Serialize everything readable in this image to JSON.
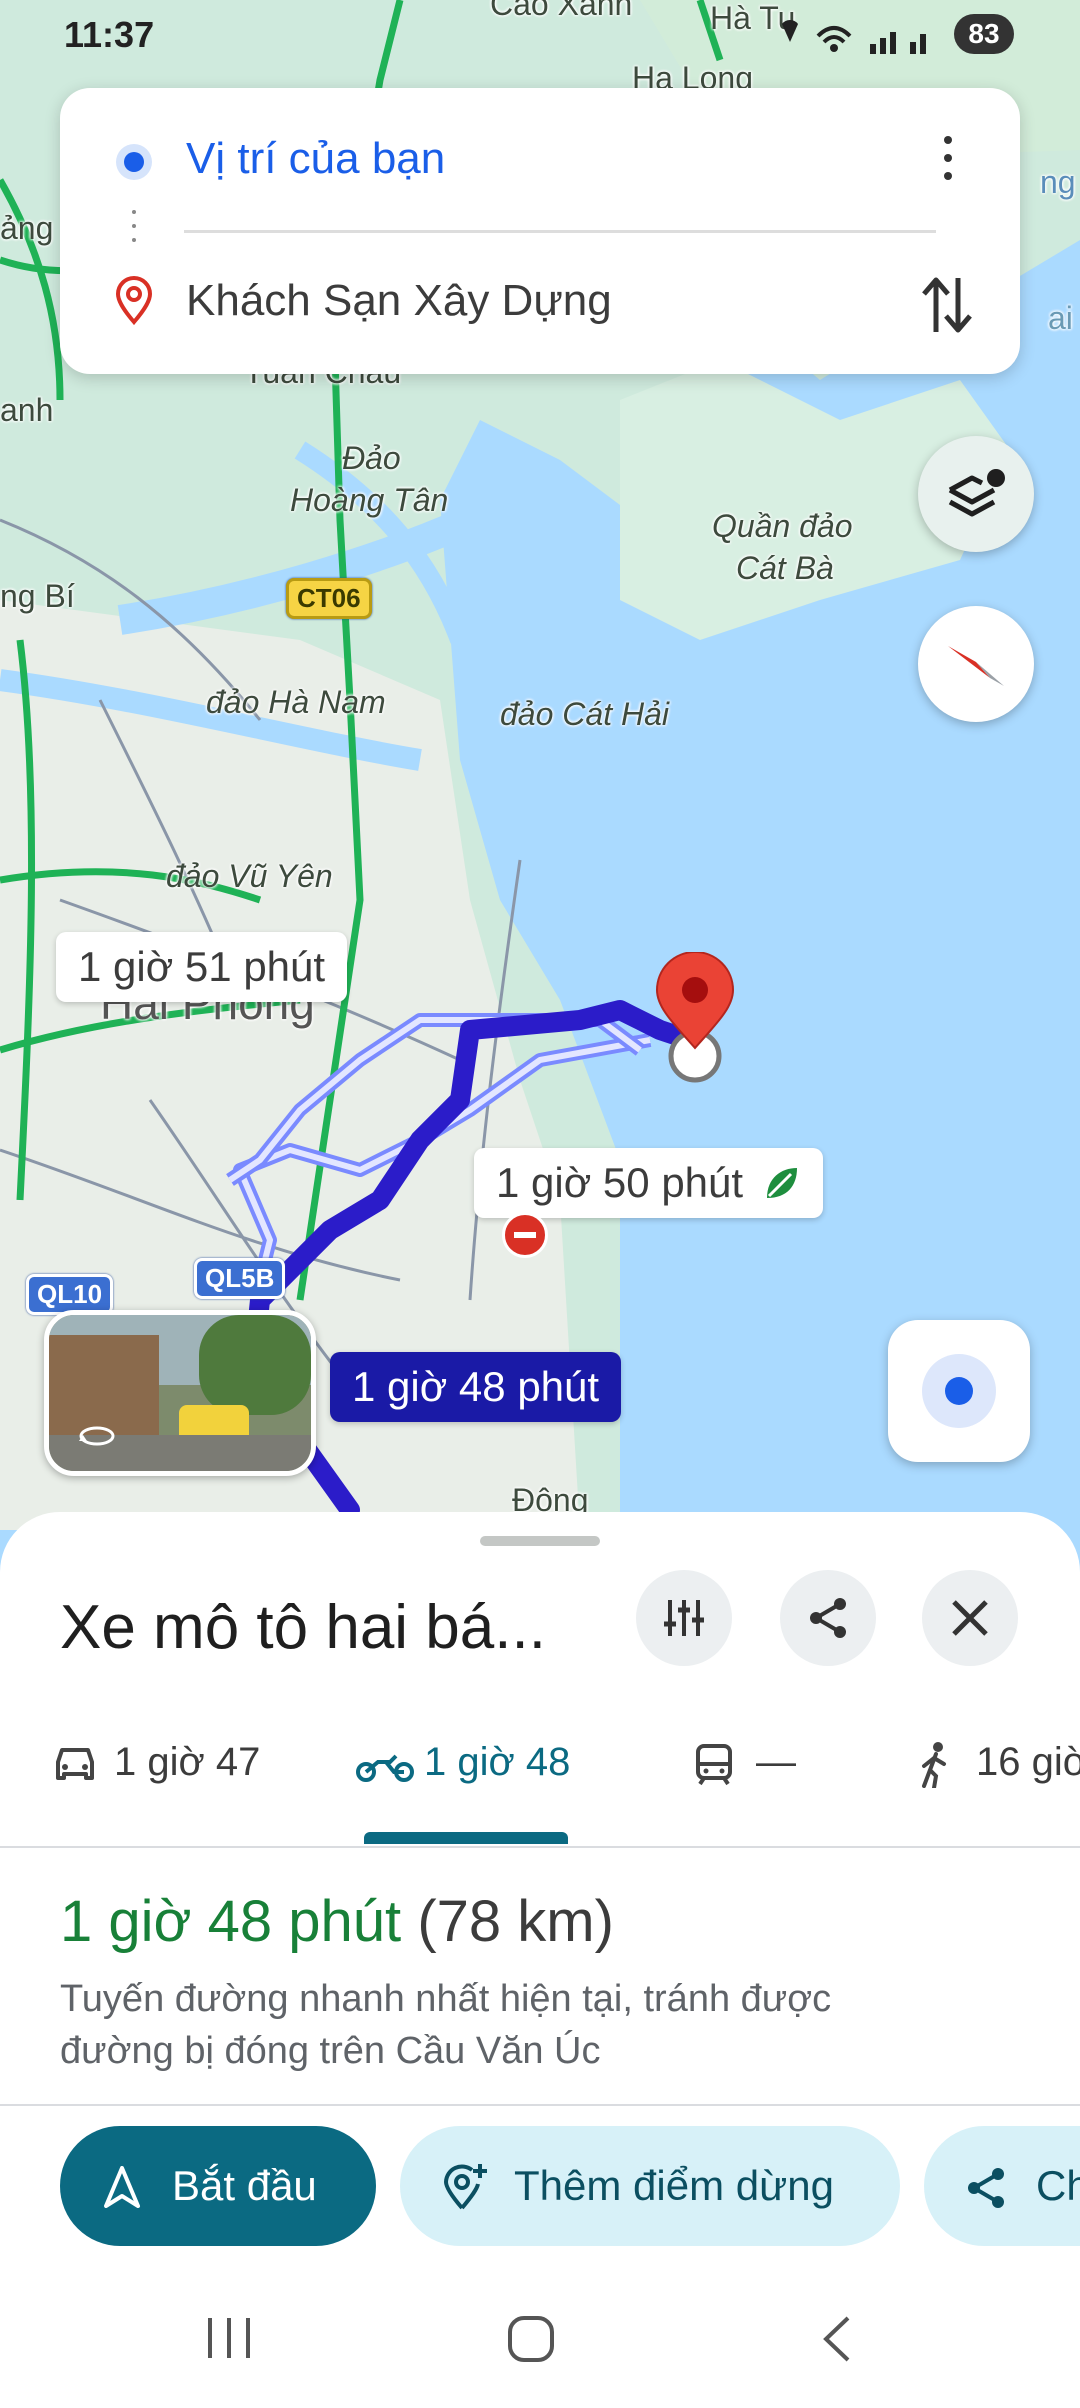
{
  "status_bar": {
    "time": "11:37",
    "battery": "83"
  },
  "route_card": {
    "origin": "Vị trí của bạn",
    "destination": "Khách Sạn Xây Dựng"
  },
  "map": {
    "labels": [
      "Cao Xanh",
      "Hà Tu",
      "Hạ Long",
      "ảng",
      "anh",
      "Tuần Châu",
      "Đảo",
      "Hoàng Tân",
      "ng Bí",
      "Quần đảo",
      "Cát Bà",
      "đảo Hà Nam",
      "đảo Cát Hải",
      "đảo Vũ Yên",
      "Hải Phòng",
      "Đông",
      "ai",
      "ng"
    ],
    "road_badges": [
      "CT06",
      "QL10",
      "QL5B"
    ],
    "route_times": [
      "1 giờ 51 phút",
      "1 giờ 50 phút",
      "1 giờ 48 phút"
    ]
  },
  "sheet": {
    "title": "Xe mô tô hai bá...",
    "modes": [
      {
        "icon": "car-icon",
        "label": "1 giờ 47"
      },
      {
        "icon": "motorcycle-icon",
        "label": "1 giờ 48"
      },
      {
        "icon": "transit-icon",
        "label": "—"
      },
      {
        "icon": "walk-icon",
        "label": "16 giờ"
      }
    ],
    "duration": "1 giờ 48 phút",
    "distance": "(78 km)",
    "description_line1": "Tuyến đường nhanh nhất hiện tại, tránh được",
    "description_line2": "đường bị đóng trên Cầu Văn Úc",
    "start_label": "Bắt đầu",
    "add_stop_label": "Thêm điểm dừng",
    "share_label": "Ch"
  },
  "colors": {
    "accent": "#1a73e8",
    "route": "#2b1cc9",
    "green_text": "#188038",
    "start_button": "#0b6a82"
  }
}
